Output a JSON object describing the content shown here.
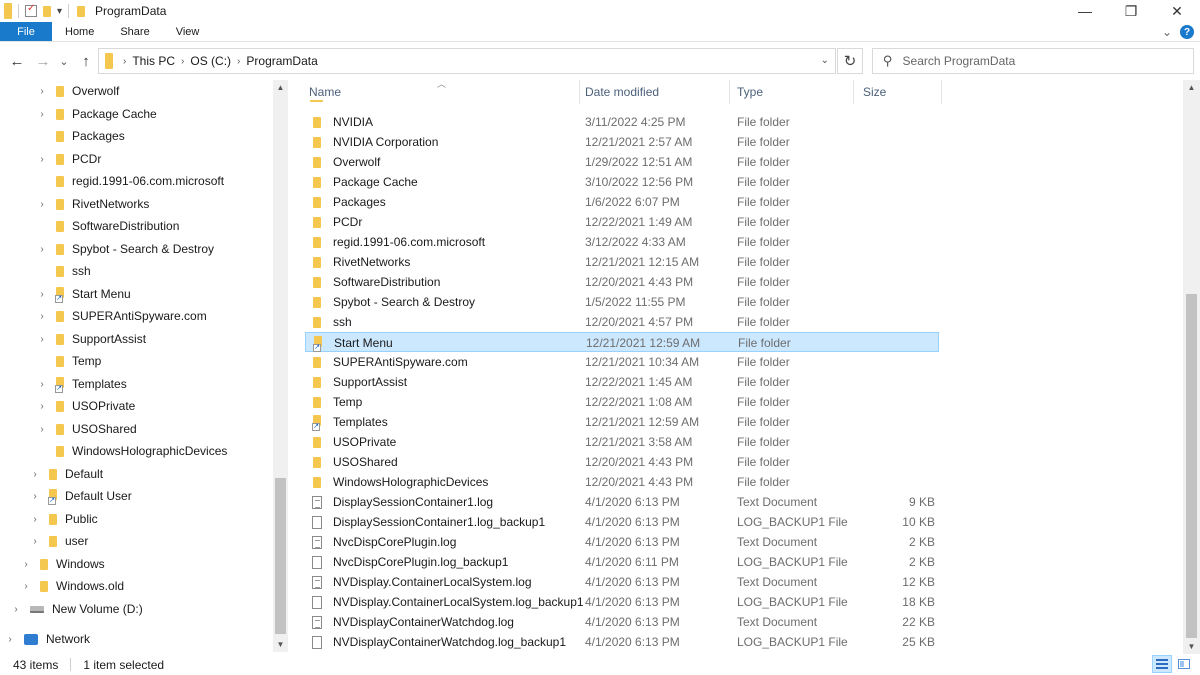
{
  "titlebar": {
    "title": "ProgramData",
    "minimize_glyph": "—",
    "maximize_glyph": "❐",
    "close_glyph": "✕",
    "qa_dropdown_glyph": "▾"
  },
  "ribbon": {
    "tabs": [
      "File",
      "Home",
      "Share",
      "View"
    ],
    "collapse_glyph": "⌄",
    "help_glyph": "?",
    "accent": "#1979ca"
  },
  "nav_buttons": {
    "back": "←",
    "forward": "→",
    "recent": "⌄",
    "up": "↑"
  },
  "address": {
    "crumbs": [
      "This PC",
      "OS (C:)",
      "ProgramData"
    ],
    "separator": "›",
    "dropdown_glyph": "⌄",
    "refresh_glyph": "↻"
  },
  "search": {
    "placeholder": "Search ProgramData",
    "icon_glyph": "⚲"
  },
  "nav_pane": {
    "items": [
      {
        "label": "Overwolf",
        "icon": "folder-icon",
        "expandable": true
      },
      {
        "label": "Package Cache",
        "icon": "folder-icon",
        "expandable": true
      },
      {
        "label": "Packages",
        "icon": "folder-icon",
        "expandable": false
      },
      {
        "label": "PCDr",
        "icon": "folder-icon",
        "expandable": true
      },
      {
        "label": "regid.1991-06.com.microsoft",
        "icon": "folder-icon",
        "expandable": false
      },
      {
        "label": "RivetNetworks",
        "icon": "folder-icon",
        "expandable": true
      },
      {
        "label": "SoftwareDistribution",
        "icon": "folder-icon",
        "expandable": false
      },
      {
        "label": "Spybot - Search & Destroy",
        "icon": "folder-icon",
        "expandable": true
      },
      {
        "label": "ssh",
        "icon": "folder-icon",
        "expandable": false
      },
      {
        "label": "Start Menu",
        "icon": "folder-shortcut-icon",
        "expandable": true
      },
      {
        "label": "SUPERAntiSpyware.com",
        "icon": "folder-icon",
        "expandable": true
      },
      {
        "label": "SupportAssist",
        "icon": "folder-icon",
        "expandable": true
      },
      {
        "label": "Temp",
        "icon": "folder-icon",
        "expandable": false
      },
      {
        "label": "Templates",
        "icon": "folder-shortcut-icon",
        "expandable": true
      },
      {
        "label": "USOPrivate",
        "icon": "folder-icon",
        "expandable": true
      },
      {
        "label": "USOShared",
        "icon": "folder-icon",
        "expandable": true
      },
      {
        "label": "WindowsHolographicDevices",
        "icon": "folder-icon",
        "expandable": false
      },
      {
        "label": "Default",
        "icon": "folder-icon",
        "expandable": true
      },
      {
        "label": "Default User",
        "icon": "folder-shortcut-icon",
        "expandable": true
      },
      {
        "label": "Public",
        "icon": "folder-icon",
        "expandable": true
      },
      {
        "label": "user",
        "icon": "folder-icon",
        "expandable": true
      },
      {
        "label": "Windows",
        "icon": "folder-icon",
        "expandable": true
      },
      {
        "label": "Windows.old",
        "icon": "folder-icon",
        "expandable": true
      },
      {
        "label": "New Volume (D:)",
        "icon": "drive-icon",
        "expandable": true
      },
      {
        "label": "Network",
        "icon": "network-icon",
        "expandable": true
      }
    ]
  },
  "columns": {
    "name": "Name",
    "date": "Date modified",
    "type": "Type",
    "size": "Size"
  },
  "files": [
    {
      "name": "NVIDIA",
      "date": "3/11/2022 4:25 PM",
      "type": "File folder",
      "size": "",
      "icon": "folder-icon"
    },
    {
      "name": "NVIDIA Corporation",
      "date": "12/21/2021 2:57 AM",
      "type": "File folder",
      "size": "",
      "icon": "folder-icon"
    },
    {
      "name": "Overwolf",
      "date": "1/29/2022 12:51 AM",
      "type": "File folder",
      "size": "",
      "icon": "folder-icon"
    },
    {
      "name": "Package Cache",
      "date": "3/10/2022 12:56 PM",
      "type": "File folder",
      "size": "",
      "icon": "folder-icon"
    },
    {
      "name": "Packages",
      "date": "1/6/2022 6:07 PM",
      "type": "File folder",
      "size": "",
      "icon": "folder-icon"
    },
    {
      "name": "PCDr",
      "date": "12/22/2021 1:49 AM",
      "type": "File folder",
      "size": "",
      "icon": "folder-icon"
    },
    {
      "name": "regid.1991-06.com.microsoft",
      "date": "3/12/2022 4:33 AM",
      "type": "File folder",
      "size": "",
      "icon": "folder-icon"
    },
    {
      "name": "RivetNetworks",
      "date": "12/21/2021 12:15 AM",
      "type": "File folder",
      "size": "",
      "icon": "folder-icon"
    },
    {
      "name": "SoftwareDistribution",
      "date": "12/20/2021 4:43 PM",
      "type": "File folder",
      "size": "",
      "icon": "folder-icon"
    },
    {
      "name": "Spybot - Search & Destroy",
      "date": "1/5/2022 11:55 PM",
      "type": "File folder",
      "size": "",
      "icon": "folder-icon"
    },
    {
      "name": "ssh",
      "date": "12/20/2021 4:57 PM",
      "type": "File folder",
      "size": "",
      "icon": "folder-icon"
    },
    {
      "name": "Start Menu",
      "date": "12/21/2021 12:59 AM",
      "type": "File folder",
      "size": "",
      "icon": "folder-shortcut-icon",
      "selected": true
    },
    {
      "name": "SUPERAntiSpyware.com",
      "date": "12/21/2021 10:34 AM",
      "type": "File folder",
      "size": "",
      "icon": "folder-icon"
    },
    {
      "name": "SupportAssist",
      "date": "12/22/2021 1:45 AM",
      "type": "File folder",
      "size": "",
      "icon": "folder-icon"
    },
    {
      "name": "Temp",
      "date": "12/22/2021 1:08 AM",
      "type": "File folder",
      "size": "",
      "icon": "folder-icon"
    },
    {
      "name": "Templates",
      "date": "12/21/2021 12:59 AM",
      "type": "File folder",
      "size": "",
      "icon": "folder-shortcut-icon"
    },
    {
      "name": "USOPrivate",
      "date": "12/21/2021 3:58 AM",
      "type": "File folder",
      "size": "",
      "icon": "folder-icon"
    },
    {
      "name": "USOShared",
      "date": "12/20/2021 4:43 PM",
      "type": "File folder",
      "size": "",
      "icon": "folder-icon"
    },
    {
      "name": "WindowsHolographicDevices",
      "date": "12/20/2021 4:43 PM",
      "type": "File folder",
      "size": "",
      "icon": "folder-icon"
    },
    {
      "name": "DisplaySessionContainer1.log",
      "date": "4/1/2020 6:13 PM",
      "type": "Text Document",
      "size": "9 KB",
      "icon": "text-document-icon"
    },
    {
      "name": "DisplaySessionContainer1.log_backup1",
      "date": "4/1/2020 6:13 PM",
      "type": "LOG_BACKUP1 File",
      "size": "10 KB",
      "icon": "file-icon"
    },
    {
      "name": "NvcDispCorePlugin.log",
      "date": "4/1/2020 6:13 PM",
      "type": "Text Document",
      "size": "2 KB",
      "icon": "text-document-icon"
    },
    {
      "name": "NvcDispCorePlugin.log_backup1",
      "date": "4/1/2020 6:11 PM",
      "type": "LOG_BACKUP1 File",
      "size": "2 KB",
      "icon": "file-icon"
    },
    {
      "name": "NVDisplay.ContainerLocalSystem.log",
      "date": "4/1/2020 6:13 PM",
      "type": "Text Document",
      "size": "12 KB",
      "icon": "text-document-icon"
    },
    {
      "name": "NVDisplay.ContainerLocalSystem.log_backup1",
      "date": "4/1/2020 6:13 PM",
      "type": "LOG_BACKUP1 File",
      "size": "18 KB",
      "icon": "file-icon"
    },
    {
      "name": "NVDisplayContainerWatchdog.log",
      "date": "4/1/2020 6:13 PM",
      "type": "Text Document",
      "size": "22 KB",
      "icon": "text-document-icon"
    },
    {
      "name": "NVDisplayContainerWatchdog.log_backup1",
      "date": "4/1/2020 6:13 PM",
      "type": "LOG_BACKUP1 File",
      "size": "25 KB",
      "icon": "file-icon"
    }
  ],
  "status": {
    "count": "43 items",
    "selection": "1 item selected"
  },
  "colors": {
    "selection_bg": "#cce8ff",
    "selection_border": "#99d1ff",
    "folder": "#f4c74f",
    "column_header_text": "#4c607a"
  }
}
